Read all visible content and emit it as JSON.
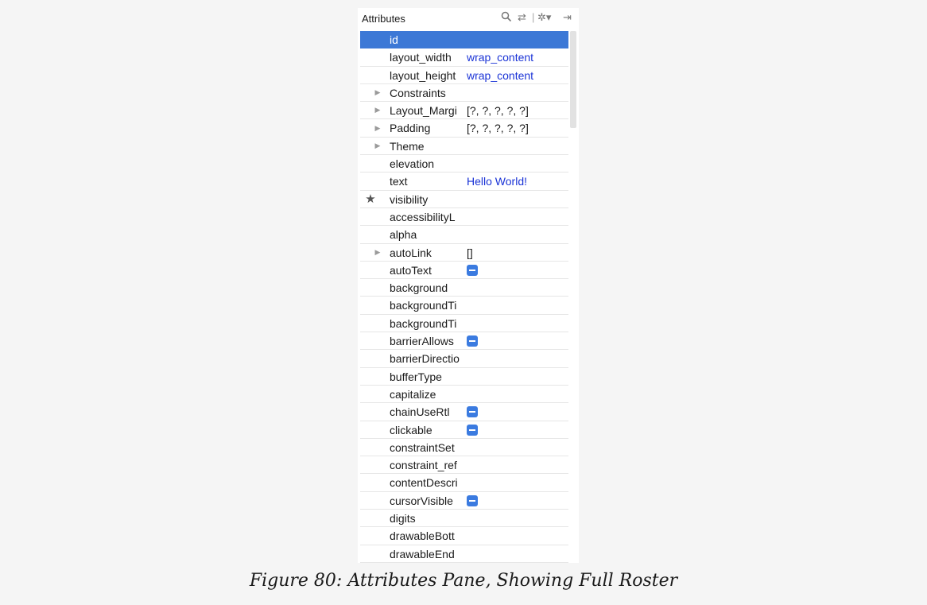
{
  "header": {
    "title": "Attributes",
    "icons": [
      "search-icon",
      "swap-icon",
      "gear-icon",
      "dock-icon"
    ]
  },
  "rows": [
    {
      "name": "id",
      "value": "",
      "selected": true
    },
    {
      "name": "layout_width",
      "value": "wrap_content",
      "value_style": "blue"
    },
    {
      "name": "layout_height",
      "value": "wrap_content",
      "value_style": "blue"
    },
    {
      "name": "Constraints",
      "value": "",
      "expandable": true
    },
    {
      "name": "Layout_Margi",
      "value": "[?, ?, ?, ?, ?]",
      "expandable": true
    },
    {
      "name": "Padding",
      "value": "[?, ?, ?, ?, ?]",
      "expandable": true
    },
    {
      "name": "Theme",
      "value": "",
      "expandable": true
    },
    {
      "name": "elevation",
      "value": ""
    },
    {
      "name": "text",
      "value": "Hello World!",
      "value_style": "blue"
    },
    {
      "name": "visibility",
      "value": "",
      "starred": true
    },
    {
      "name": "accessibilityL",
      "value": ""
    },
    {
      "name": "alpha",
      "value": ""
    },
    {
      "name": "autoLink",
      "value": "[]",
      "expandable": true
    },
    {
      "name": "autoText",
      "value": "",
      "checkbox": "indeterminate"
    },
    {
      "name": "background",
      "value": ""
    },
    {
      "name": "backgroundTi",
      "value": ""
    },
    {
      "name": "backgroundTi",
      "value": ""
    },
    {
      "name": "barrierAllows",
      "value": "",
      "checkbox": "indeterminate"
    },
    {
      "name": "barrierDirectio",
      "value": ""
    },
    {
      "name": "bufferType",
      "value": ""
    },
    {
      "name": "capitalize",
      "value": ""
    },
    {
      "name": "chainUseRtl",
      "value": "",
      "checkbox": "indeterminate"
    },
    {
      "name": "clickable",
      "value": "",
      "checkbox": "indeterminate"
    },
    {
      "name": "constraintSet",
      "value": ""
    },
    {
      "name": "constraint_ref",
      "value": ""
    },
    {
      "name": "contentDescri",
      "value": ""
    },
    {
      "name": "cursorVisible",
      "value": "",
      "checkbox": "indeterminate"
    },
    {
      "name": "digits",
      "value": ""
    },
    {
      "name": "drawableBott",
      "value": ""
    },
    {
      "name": "drawableEnd",
      "value": ""
    }
  ],
  "caption": "Figure 80: Attributes Pane, Showing Full Roster"
}
